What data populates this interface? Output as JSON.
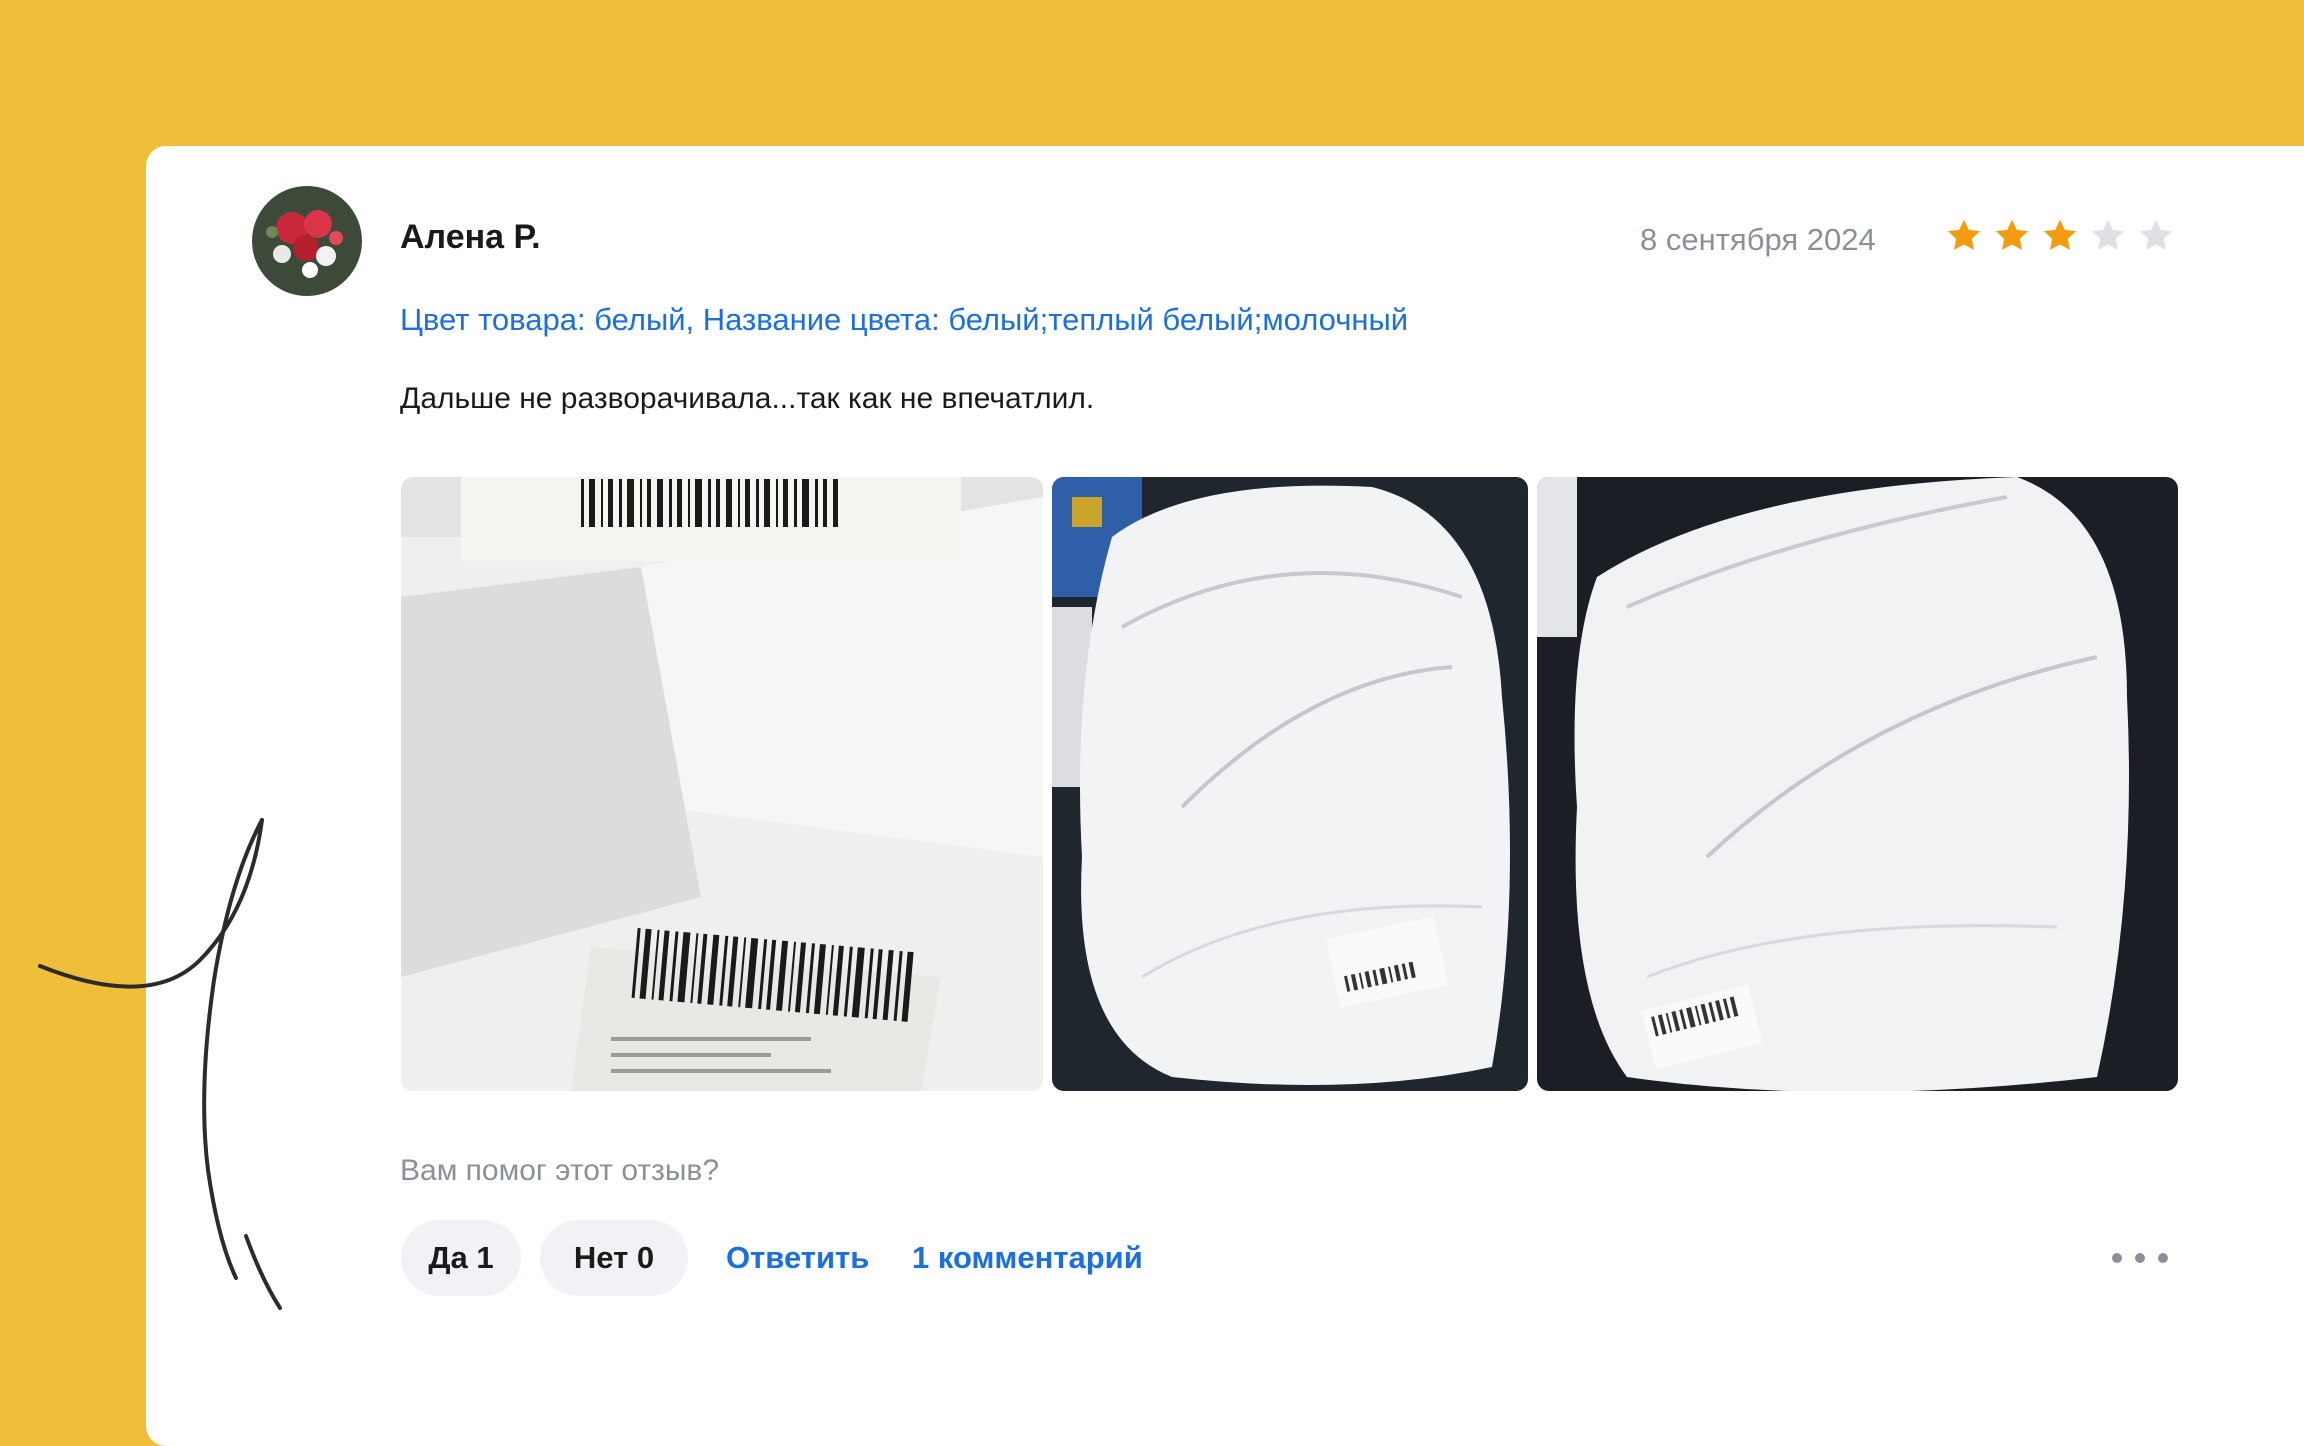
{
  "review": {
    "author": "Алена Р.",
    "date": "8 сентября 2024",
    "rating": 3,
    "rating_max": 5,
    "variant": "Цвет товара: белый, Название цвета: белый;теплый белый;молочный",
    "text": "Дальше не разворачивала...так как не впечатлил.",
    "photo_count": 3
  },
  "feedback": {
    "question": "Вам помог этот отзыв?",
    "yes_label": "Да 1",
    "no_label": "Нет 0",
    "reply_label": "Ответить",
    "comments_label": "1 комментарий"
  },
  "colors": {
    "background": "#F0BF3A",
    "link": "#1a6ee8",
    "star_filled": "#F29D11",
    "star_empty": "#DDE1E6",
    "muted_text": "#8a9099"
  },
  "icons": [
    "star-icon",
    "more-icon",
    "avatar"
  ]
}
